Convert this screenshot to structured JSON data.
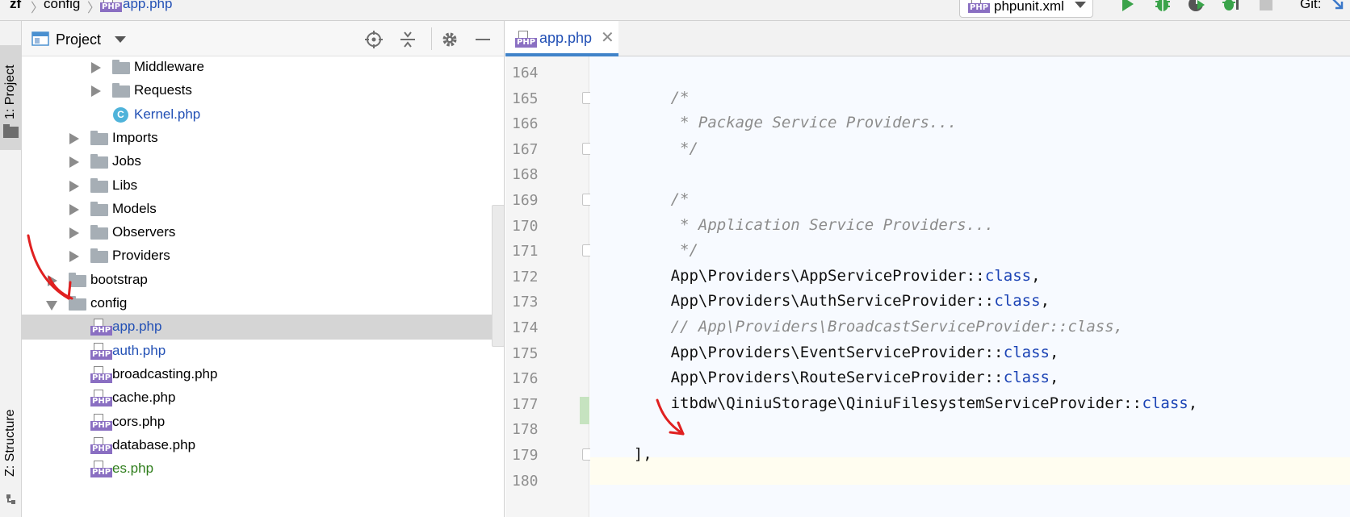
{
  "breadcrumb": {
    "items": [
      "zf",
      "config",
      "app.php"
    ]
  },
  "toolbar": {
    "run_config": "phpunit.xml",
    "git_label": "Git:",
    "icons": [
      "run-icon",
      "debug-icon",
      "coverage-icon",
      "profile-icon",
      "stop-icon"
    ]
  },
  "left_strip": {
    "project_tab": "1: Project",
    "structure_tab": "Z: Structure"
  },
  "project_panel": {
    "title": "Project",
    "icons": [
      "locate-icon",
      "collapse-icon",
      "gear-icon",
      "minimize-icon"
    ]
  },
  "tree": [
    {
      "label": "Middleware",
      "type": "folder",
      "depth": 3,
      "expanded": false
    },
    {
      "label": "Requests",
      "type": "folder",
      "depth": 3,
      "expanded": false
    },
    {
      "label": "Kernel.php",
      "type": "class",
      "depth": 3,
      "color": "#2250b5"
    },
    {
      "label": "Imports",
      "type": "folder",
      "depth": 2,
      "expanded": false
    },
    {
      "label": "Jobs",
      "type": "folder",
      "depth": 2,
      "expanded": false
    },
    {
      "label": "Libs",
      "type": "folder",
      "depth": 2,
      "expanded": false
    },
    {
      "label": "Models",
      "type": "folder",
      "depth": 2,
      "expanded": false
    },
    {
      "label": "Observers",
      "type": "folder",
      "depth": 2,
      "expanded": false
    },
    {
      "label": "Providers",
      "type": "folder",
      "depth": 2,
      "expanded": false
    },
    {
      "label": "bootstrap",
      "type": "folder",
      "depth": 1,
      "expanded": false
    },
    {
      "label": "config",
      "type": "folder",
      "depth": 1,
      "expanded": true
    },
    {
      "label": "app.php",
      "type": "php",
      "depth": 2,
      "selected": true,
      "color": "#2250b5"
    },
    {
      "label": "auth.php",
      "type": "php",
      "depth": 2,
      "color": "#2250b5"
    },
    {
      "label": "broadcasting.php",
      "type": "php",
      "depth": 2
    },
    {
      "label": "cache.php",
      "type": "php",
      "depth": 2
    },
    {
      "label": "cors.php",
      "type": "php",
      "depth": 2
    },
    {
      "label": "database.php",
      "type": "php",
      "depth": 2
    },
    {
      "label": "es.php",
      "type": "php",
      "depth": 2,
      "color": "#2e7d1b"
    }
  ],
  "editor": {
    "tab_label": "app.php",
    "lines": [
      {
        "num": "164",
        "parts": []
      },
      {
        "num": "165",
        "parts": [
          {
            "t": "/*",
            "c": "comment"
          }
        ],
        "indent": 8
      },
      {
        "num": "166",
        "parts": [
          {
            "t": " * Package Service Providers...",
            "c": "comment"
          }
        ],
        "indent": 8
      },
      {
        "num": "167",
        "parts": [
          {
            "t": " */",
            "c": "comment"
          }
        ],
        "indent": 8
      },
      {
        "num": "168",
        "parts": []
      },
      {
        "num": "169",
        "parts": [
          {
            "t": "/*",
            "c": "comment"
          }
        ],
        "indent": 8
      },
      {
        "num": "170",
        "parts": [
          {
            "t": " * Application Service Providers...",
            "c": "comment"
          }
        ],
        "indent": 8
      },
      {
        "num": "171",
        "parts": [
          {
            "t": " */",
            "c": "comment"
          }
        ],
        "indent": 8
      },
      {
        "num": "172",
        "parts": [
          {
            "t": "App\\Providers\\AppServiceProvider::",
            "c": "plain"
          },
          {
            "t": "class",
            "c": "kw"
          },
          {
            "t": ",",
            "c": "plain"
          }
        ],
        "indent": 8
      },
      {
        "num": "173",
        "parts": [
          {
            "t": "App\\Providers\\AuthServiceProvider::",
            "c": "plain"
          },
          {
            "t": "class",
            "c": "kw"
          },
          {
            "t": ",",
            "c": "plain"
          }
        ],
        "indent": 8
      },
      {
        "num": "174",
        "parts": [
          {
            "t": "// App\\Providers\\BroadcastServiceProvider::class,",
            "c": "comment"
          }
        ],
        "indent": 8
      },
      {
        "num": "175",
        "parts": [
          {
            "t": "App\\Providers\\EventServiceProvider::",
            "c": "plain"
          },
          {
            "t": "class",
            "c": "kw"
          },
          {
            "t": ",",
            "c": "plain"
          }
        ],
        "indent": 8
      },
      {
        "num": "176",
        "parts": [
          {
            "t": "App\\Providers\\RouteServiceProvider::",
            "c": "plain"
          },
          {
            "t": "class",
            "c": "kw"
          },
          {
            "t": ",",
            "c": "plain"
          }
        ],
        "indent": 8
      },
      {
        "num": "177",
        "parts": [
          {
            "t": "itbdw\\QiniuStorage\\QiniuFilesystemServiceProvider::",
            "c": "plain"
          },
          {
            "t": "class",
            "c": "kw"
          },
          {
            "t": ",",
            "c": "plain"
          }
        ],
        "indent": 8
      },
      {
        "num": "178",
        "parts": []
      },
      {
        "num": "179",
        "parts": [
          {
            "t": "],",
            "c": "plain"
          }
        ],
        "indent": 4
      },
      {
        "num": "180",
        "parts": []
      }
    ]
  },
  "colors": {
    "accent": "#4083c9",
    "php_badge": "#8a6fc2",
    "keyword": "#1b43b5",
    "annotation_red": "#e02020"
  }
}
